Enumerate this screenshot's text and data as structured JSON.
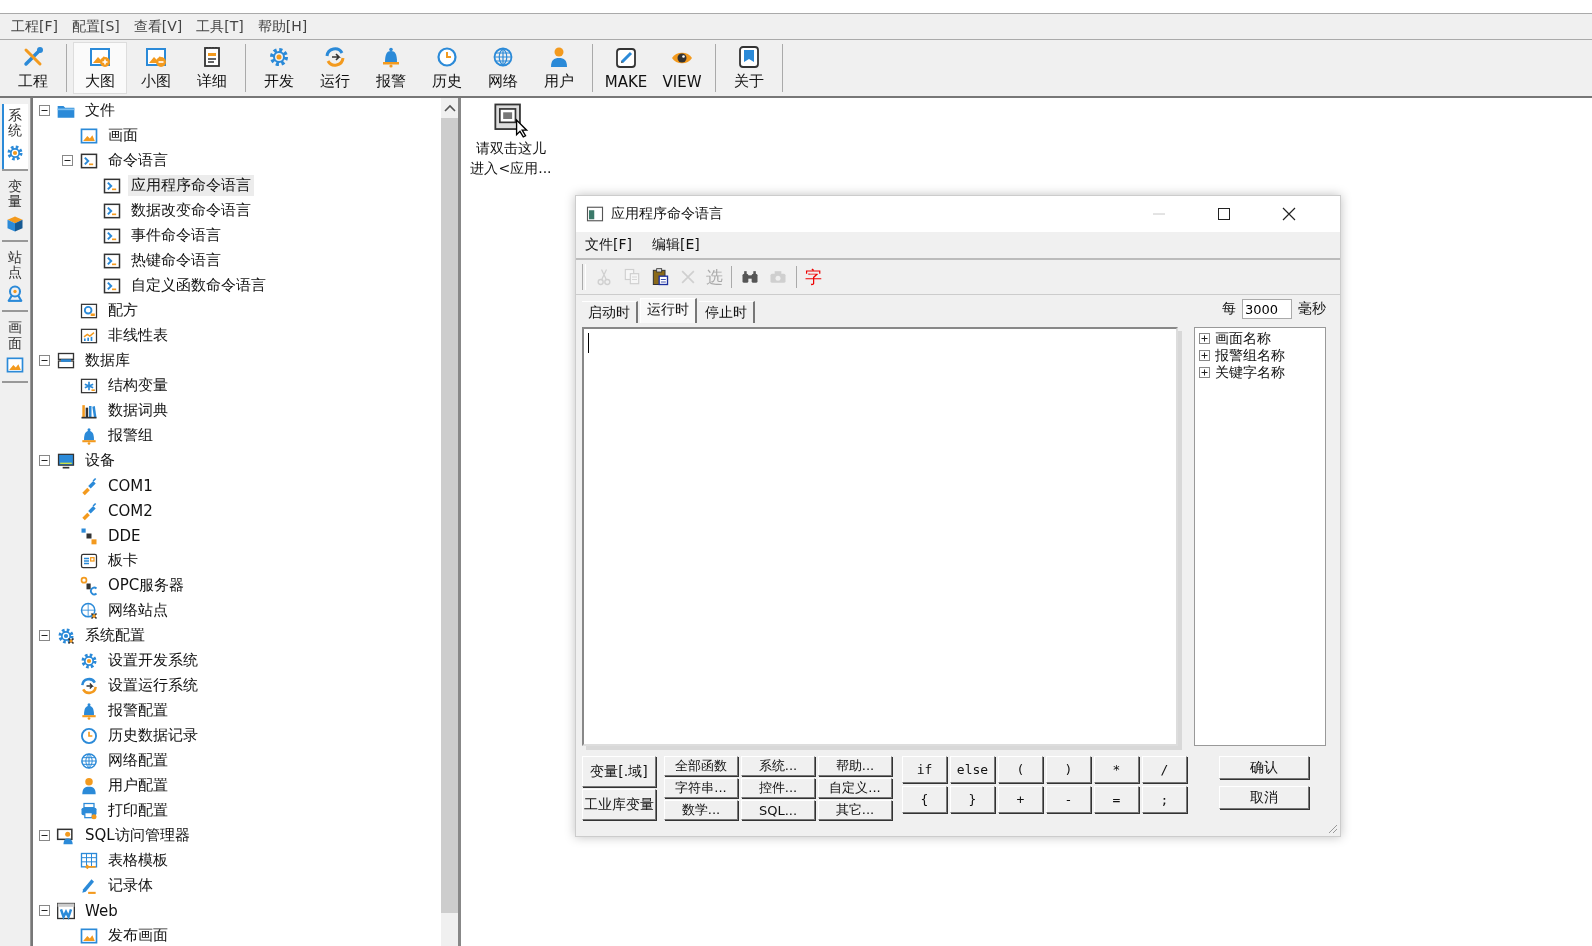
{
  "menu": [
    "工程[F]",
    "配置[S]",
    "查看[V]",
    "工具[T]",
    "帮助[H]"
  ],
  "toolbar_groups": [
    {
      "buttons": [
        {
          "label": "工程",
          "selected": false
        }
      ]
    },
    {
      "buttons": [
        {
          "label": "大图",
          "selected": true
        },
        {
          "label": "小图",
          "selected": false
        },
        {
          "label": "详细",
          "selected": false
        }
      ]
    },
    {
      "buttons": [
        {
          "label": "开发",
          "selected": false
        },
        {
          "label": "运行",
          "selected": false
        },
        {
          "label": "报警",
          "selected": false
        },
        {
          "label": "历史",
          "selected": false
        },
        {
          "label": "网络",
          "selected": false
        },
        {
          "label": "用户",
          "selected": false
        }
      ]
    },
    {
      "buttons": [
        {
          "label": "MAKE",
          "selected": false
        },
        {
          "label": "VIEW",
          "selected": false
        }
      ]
    },
    {
      "buttons": [
        {
          "label": "关于",
          "selected": false
        }
      ]
    }
  ],
  "side_tabs": [
    {
      "label": "系统",
      "selected": true
    },
    {
      "label": "变量",
      "selected": false
    },
    {
      "label": "站点",
      "selected": false
    },
    {
      "label": "画面",
      "selected": false
    }
  ],
  "tree": [
    {
      "label": "文件",
      "selected": false,
      "expanded": true,
      "children": [
        {
          "label": "画面",
          "selected": false
        },
        {
          "label": "命令语言",
          "selected": false,
          "expanded": true,
          "children": [
            {
              "label": "应用程序命令语言",
              "selected": true
            },
            {
              "label": "数据改变命令语言",
              "selected": false
            },
            {
              "label": "事件命令语言",
              "selected": false
            },
            {
              "label": "热键命令语言",
              "selected": false
            },
            {
              "label": "自定义函数命令语言",
              "selected": false
            }
          ]
        },
        {
          "label": "配方",
          "selected": false
        },
        {
          "label": "非线性表",
          "selected": false
        }
      ]
    },
    {
      "label": "数据库",
      "selected": false,
      "expanded": true,
      "children": [
        {
          "label": "结构变量",
          "selected": false
        },
        {
          "label": "数据词典",
          "selected": false
        },
        {
          "label": "报警组",
          "selected": false
        }
      ]
    },
    {
      "label": "设备",
      "selected": false,
      "expanded": true,
      "children": [
        {
          "label": "COM1",
          "selected": false
        },
        {
          "label": "COM2",
          "selected": false
        },
        {
          "label": "DDE",
          "selected": false
        },
        {
          "label": "板卡",
          "selected": false
        },
        {
          "label": "OPC服务器",
          "selected": false
        },
        {
          "label": "网络站点",
          "selected": false
        }
      ]
    },
    {
      "label": "系统配置",
      "selected": false,
      "expanded": true,
      "children": [
        {
          "label": "设置开发系统",
          "selected": false
        },
        {
          "label": "设置运行系统",
          "selected": false
        },
        {
          "label": "报警配置",
          "selected": false
        },
        {
          "label": "历史数据记录",
          "selected": false
        },
        {
          "label": "网络配置",
          "selected": false
        },
        {
          "label": "用户配置",
          "selected": false
        },
        {
          "label": "打印配置",
          "selected": false
        }
      ]
    },
    {
      "label": "SQL访问管理器",
      "selected": false,
      "expanded": true,
      "children": [
        {
          "label": "表格模板",
          "selected": false
        },
        {
          "label": "记录体",
          "selected": false
        }
      ]
    },
    {
      "label": "Web",
      "selected": false,
      "expanded": true,
      "children": [
        {
          "label": "发布画面",
          "selected": false
        }
      ]
    }
  ],
  "desktop_shortcut": {
    "lines": [
      "请双击这儿",
      "进入<应用..."
    ]
  },
  "dialog": {
    "title": "应用程序命令语言",
    "menu": [
      "文件[F]",
      "编辑[E]"
    ],
    "toolbar_groups": [
      {
        "items": [
          {
            "kind": "icon",
            "disabled": true
          },
          {
            "kind": "icon",
            "disabled": true
          },
          {
            "kind": "icon",
            "disabled": false
          },
          {
            "kind": "icon",
            "disabled": true
          },
          {
            "kind": "glyph",
            "text": "选",
            "disabled": true
          }
        ]
      },
      {
        "items": [
          {
            "kind": "icon",
            "disabled": false
          },
          {
            "kind": "icon",
            "disabled": true
          }
        ]
      },
      {
        "items": [
          {
            "kind": "glyph",
            "text": "字",
            "disabled": false
          }
        ]
      }
    ],
    "tabs": [
      {
        "label": "启动时",
        "selected": false
      },
      {
        "label": "运行时",
        "selected": true
      },
      {
        "label": "停止时",
        "selected": false
      }
    ],
    "interval": {
      "prefix": "每",
      "value": "3000",
      "suffix": "毫秒"
    },
    "side_tree": [
      {
        "label": "画面名称",
        "expanded": false
      },
      {
        "label": "报警组名称",
        "expanded": false
      },
      {
        "label": "关键字名称",
        "expanded": false
      }
    ],
    "variable_buttons": [
      "变量[.域]",
      "工业库变量"
    ],
    "function_buttons": [
      "全部函数",
      "系统...",
      "帮助...",
      "字符串...",
      "控件...",
      "自定义...",
      "数学...",
      "SQL...",
      "其它..."
    ],
    "operator_buttons": [
      "if",
      "else",
      "(",
      ")",
      "*",
      "/",
      "{",
      "}",
      "+",
      "-",
      "=",
      ";"
    ],
    "action_buttons": [
      "确认",
      "取消"
    ]
  }
}
